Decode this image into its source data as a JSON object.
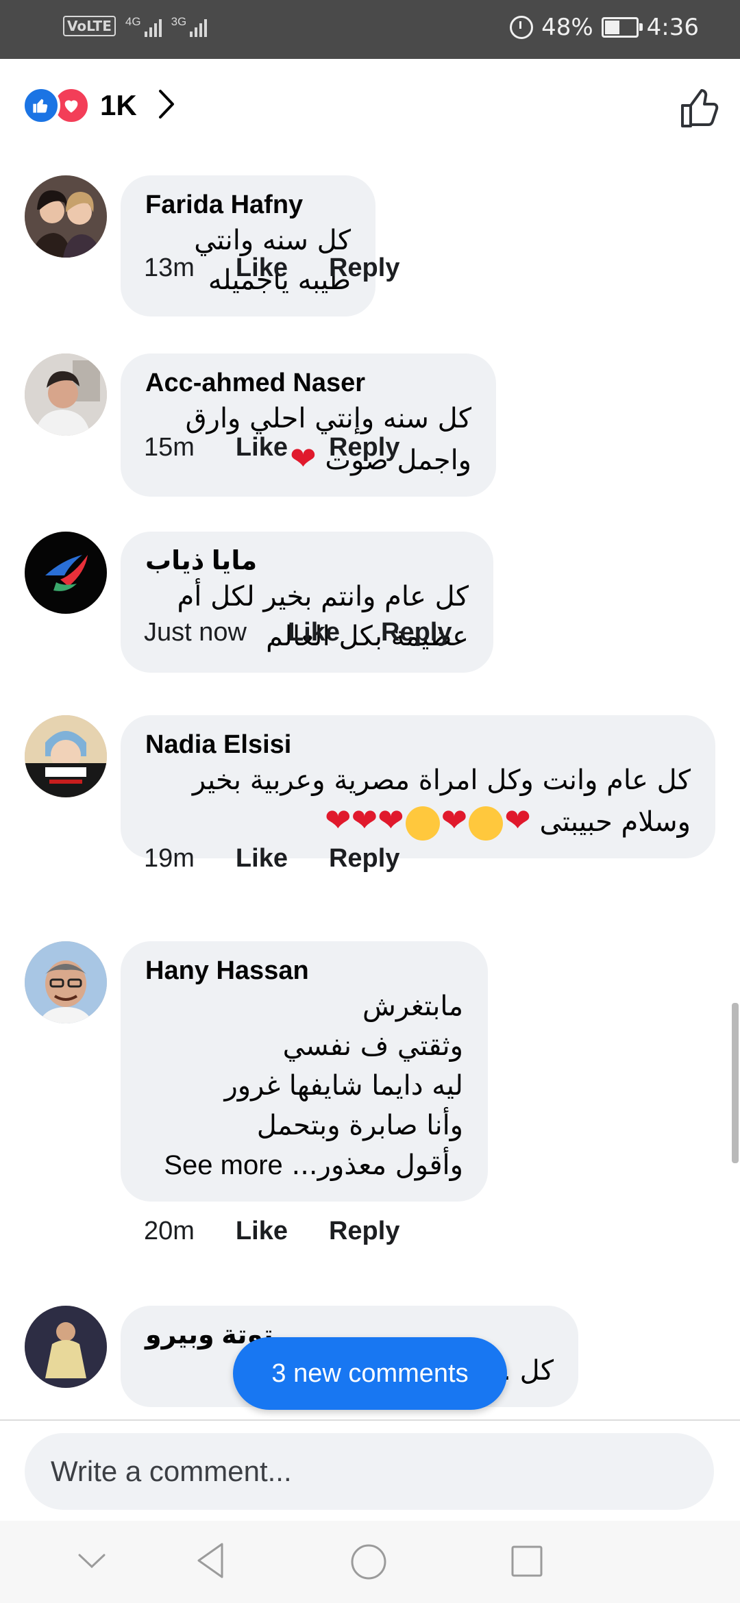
{
  "status_bar": {
    "volte": "VoLTE",
    "net1": "4G",
    "net2": "3G",
    "battery": "48%",
    "time": "4:36"
  },
  "reactions": {
    "count": "1K"
  },
  "comments": [
    {
      "author": "Farida Hafny",
      "lines": [
        "كل سنه وانتي طيبه ياجميله"
      ],
      "time": "13m",
      "like": "Like",
      "reply": "Reply"
    },
    {
      "author": "Acc-ahmed Naser",
      "lines": [
        "كل سنه وإنتي احلي وارق واجمل صوت"
      ],
      "time": "15m",
      "like": "Like",
      "reply": "Reply"
    },
    {
      "author": "مايا ذياب",
      "lines": [
        "كل عام وانتم بخير لكل أم عظيمة بكل العالم"
      ],
      "time": "Just now",
      "like": "Like",
      "reply": "Reply"
    },
    {
      "author": "Nadia Elsisi",
      "lines": [
        "كل عام وانت وكل امراة مصرية وعربية بخير",
        "وسلام حبيبتى"
      ],
      "time": "19m",
      "like": "Like",
      "reply": "Reply"
    },
    {
      "author": "Hany Hassan",
      "lines": [
        "مابتغرش",
        "وثقتي ف نفسي",
        "ليه دايما شايفها غرور",
        "وأنا صابرة وبتحمل",
        "وأقول معذور..."
      ],
      "see_more": "See more",
      "time": "20m",
      "like": "Like",
      "reply": "Reply"
    },
    {
      "author": "توتة وبيرو",
      "lines": [
        "كل ... وسعادة"
      ]
    }
  ],
  "new_comments": "3 new comments",
  "composer": {
    "placeholder": "Write a comment..."
  },
  "colors": {
    "accent": "#1877f2",
    "bubble": "#eff1f4",
    "heart": "#e0192c"
  }
}
